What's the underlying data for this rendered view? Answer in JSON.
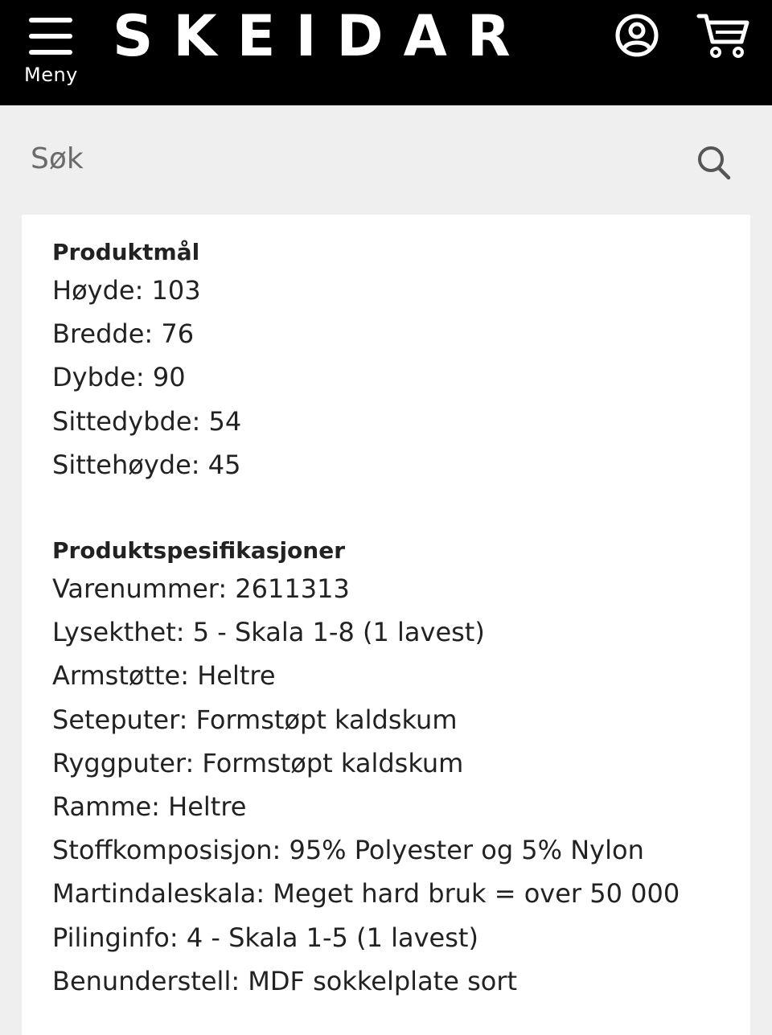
{
  "header": {
    "brand": "SKEIDAR",
    "menu_label": "Meny",
    "menu_icon": "hamburger-icon",
    "account_icon": "user-account-icon",
    "cart_icon": "shopping-cart-icon",
    "background_color": "#000000"
  },
  "search": {
    "placeholder": "Søk",
    "value": "",
    "icon": "search-icon"
  },
  "product_dimensions": {
    "heading": "Produktmål",
    "items": [
      "Høyde: 103",
      "Bredde: 76",
      "Dybde: 90",
      "Sittedybde: 54",
      "Sittehøyde: 45"
    ]
  },
  "product_specifications": {
    "heading": "Produktspesifikasjoner",
    "items": [
      "Varenummer: 2611313",
      "Lysekthet: 5 - Skala 1-8 (1 lavest)",
      "Armstøtte: Heltre",
      "Seteputer: Formstøpt kaldskum",
      "Ryggputer: Formstøpt kaldskum",
      "Ramme: Heltre",
      "Stoffkomposisjon: 95% Polyester og 5% Nylon",
      "Martindaleskala: Meget hard bruk = over 50 000",
      "Pilinginfo: 4 - Skala 1-5 (1 lavest)",
      "Benunderstell: MDF sokkelplate sort"
    ]
  }
}
